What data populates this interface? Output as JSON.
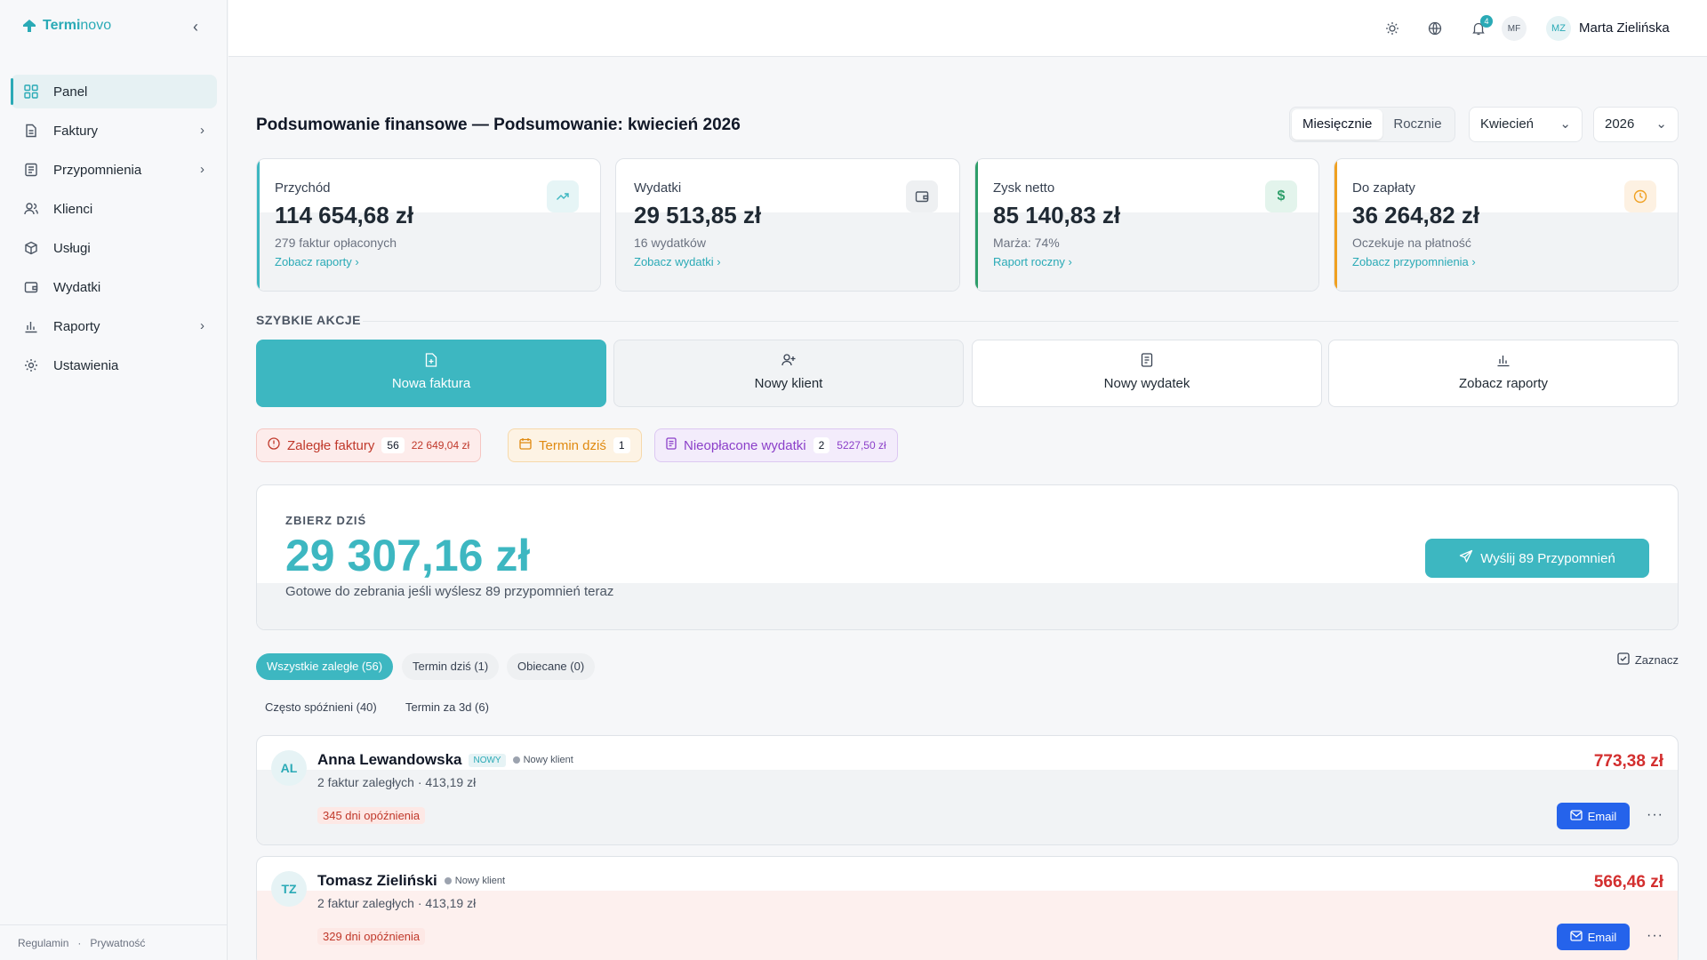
{
  "app": {
    "brand_a": "Termi",
    "brand_b": "novo"
  },
  "sidebar": {
    "items": [
      {
        "label": "Panel",
        "icon": "grid-icon",
        "active": true,
        "chevron": false
      },
      {
        "label": "Faktury",
        "icon": "file-icon",
        "active": false,
        "chevron": true
      },
      {
        "label": "Przypomnienia",
        "icon": "receipt-icon",
        "active": false,
        "chevron": true
      },
      {
        "label": "Klienci",
        "icon": "users-icon",
        "active": false,
        "chevron": false
      },
      {
        "label": "Usługi",
        "icon": "box-icon",
        "active": false,
        "chevron": false
      },
      {
        "label": "Wydatki",
        "icon": "wallet-icon",
        "active": false,
        "chevron": false
      },
      {
        "label": "Raporty",
        "icon": "chart-icon",
        "active": false,
        "chevron": true
      },
      {
        "label": "Ustawienia",
        "icon": "gear-icon",
        "active": false,
        "chevron": false
      }
    ],
    "footer": {
      "terms": "Regulamin",
      "sep": "·",
      "privacy": "Prywatność"
    }
  },
  "topbar": {
    "notif_count": "4",
    "org_initials": "MF",
    "user_initials": "MZ",
    "user_name": "Marta Zielińska"
  },
  "header": {
    "title": "Podsumowanie finansowe — Podsumowanie: kwiecień 2026",
    "period_monthly": "Miesięcznie",
    "period_yearly": "Rocznie",
    "month": "Kwiecień",
    "year": "2026"
  },
  "kpis": [
    {
      "label": "Przychód",
      "value": "114 654,68 zł",
      "sub": "279 faktur opłaconych",
      "link": "Zobacz raporty",
      "accent": "#3db7c1",
      "icon": "trending-up-icon"
    },
    {
      "label": "Wydatki",
      "value": "29 513,85 zł",
      "sub": "16 wydatków",
      "link": "Zobacz wydatki",
      "accent": "#ffffff",
      "icon": "wallet-icon"
    },
    {
      "label": "Zysk netto",
      "value": "85 140,83 zł",
      "sub": "Marża: 74%",
      "link": "Raport roczny",
      "accent": "#2e9e6a",
      "icon": "dollar-icon"
    },
    {
      "label": "Do zapłaty",
      "value": "36 264,82 zł",
      "sub": "Oczekuje na płatność",
      "link": "Zobacz przypomnienia",
      "accent": "#f0a020",
      "icon": "clock-icon"
    }
  ],
  "quick_actions": {
    "title": "SZYBKIE AKCJE",
    "items": [
      {
        "label": "Nowa faktura"
      },
      {
        "label": "Nowy klient"
      },
      {
        "label": "Nowy wydatek"
      },
      {
        "label": "Zobacz raporty"
      }
    ]
  },
  "alerts": [
    {
      "label": "Zaległe faktury",
      "count": "56",
      "amount": "22 649,04 zł"
    },
    {
      "label": "Termin dziś",
      "count": "1"
    },
    {
      "label": "Nieopłacone wydatki",
      "count": "2",
      "amount": "5227,50 zł"
    }
  ],
  "collect": {
    "kicker": "ZBIERZ DZIŚ",
    "amount": "29 307,16 zł",
    "hint": "Gotowe do zebrania jeśli wyślesz 89 przypomnień teraz",
    "button": "Wyślij 89 Przypomnień"
  },
  "filters": {
    "chips": [
      "Wszystkie zaległe (56)",
      "Termin dziś (1)",
      "Obiecane (0)"
    ],
    "chips2": [
      "Często spóźnieni (40)",
      "Termin za 3d (6)"
    ],
    "select": "Zaznacz"
  },
  "clients": [
    {
      "initials": "AL",
      "name": "Anna Lewandowska",
      "new_badge": "NOWY",
      "tag": "Nowy klient",
      "meta": "2 faktur zaległych · 413,19 zł",
      "late": "345 dni opóźnienia",
      "amount": "773,38 zł",
      "email": "Email"
    },
    {
      "initials": "TZ",
      "name": "Tomasz Zieliński",
      "tag": "Nowy klient",
      "meta": "2 faktur zaległych · 413,19 zł",
      "late": "329 dni opóźnienia",
      "amount": "566,46 zł",
      "email": "Email"
    }
  ]
}
